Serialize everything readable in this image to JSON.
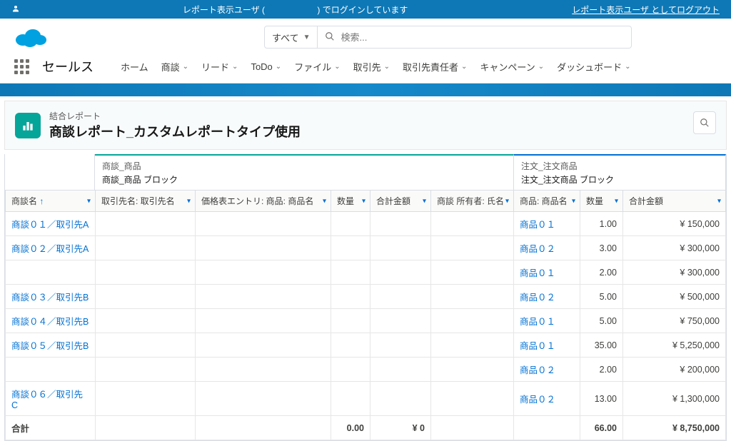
{
  "sysbar": {
    "user_label": "レポート表示ユーザ (",
    "login_msg": ") でログインしています",
    "logout": "レポート表示ユーザ としてログアウト"
  },
  "search": {
    "type_label": "すべて",
    "placeholder": "検索..."
  },
  "nav": {
    "app_name": "セールス",
    "items": [
      "ホーム",
      "商談",
      "リード",
      "ToDo",
      "ファイル",
      "取引先",
      "取引先責任者",
      "キャンペーン",
      "ダッシュボード"
    ]
  },
  "report": {
    "subtitle": "結合レポート",
    "title": "商談レポート_カスタムレポートタイプ使用"
  },
  "blocks": {
    "b1": {
      "title": "商談_商品",
      "sub": "商談_商品 ブロック"
    },
    "b2": {
      "title": "注文_注文商品",
      "sub": "注文_注文商品 ブロック"
    }
  },
  "cols": {
    "name": "商談名",
    "acct": "取引先名: 取引先名",
    "prod": "価格表エントリ: 商品: 商品名",
    "qty": "数量",
    "amt": "合計金額",
    "owner": "商談 所有者: 氏名",
    "p2": "商品: 商品名",
    "q2": "数量",
    "a2": "合計金額"
  },
  "rows": [
    {
      "name": "商談０１／取引先A",
      "p2": "商品０１",
      "q2": "1.00",
      "a2": "¥ 150,000"
    },
    {
      "name": "商談０２／取引先A",
      "p2": "商品０２",
      "q2": "3.00",
      "a2": "¥ 300,000"
    },
    {
      "name": "",
      "p2": "商品０１",
      "q2": "2.00",
      "a2": "¥ 300,000"
    },
    {
      "name": "商談０３／取引先B",
      "p2": "商品０２",
      "q2": "5.00",
      "a2": "¥ 500,000"
    },
    {
      "name": "商談０４／取引先B",
      "p2": "商品０１",
      "q2": "5.00",
      "a2": "¥ 750,000"
    },
    {
      "name": "商談０５／取引先B",
      "p2": "商品０１",
      "q2": "35.00",
      "a2": "¥ 5,250,000"
    },
    {
      "name": "",
      "p2": "商品０２",
      "q2": "2.00",
      "a2": "¥ 200,000"
    },
    {
      "name": "商談０６／取引先C",
      "p2": "商品０２",
      "q2": "13.00",
      "a2": "¥ 1,300,000"
    }
  ],
  "totals": {
    "label": "合計",
    "qty": "0.00",
    "amt": "¥ 0",
    "q2": "66.00",
    "a2": "¥ 8,750,000"
  }
}
